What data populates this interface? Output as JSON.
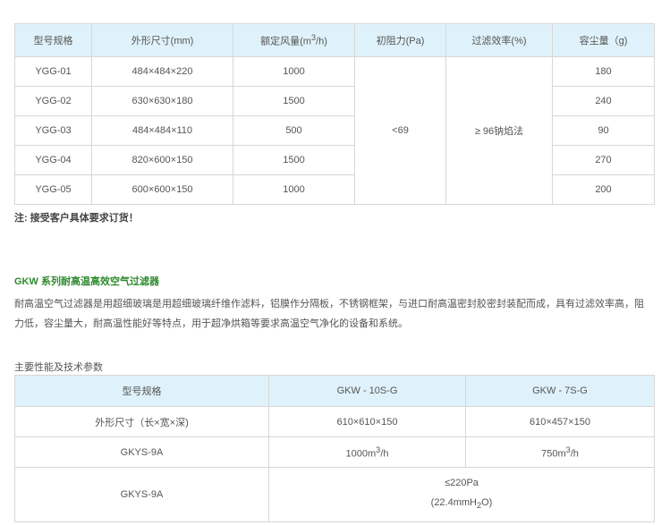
{
  "table1": {
    "headers": {
      "model": "型号规格",
      "size": "外形尺寸(mm)",
      "airflow_pre": "额定风量(m",
      "airflow_sup": "3",
      "airflow_post": "/h)",
      "resistance": "初阻力(Pa)",
      "efficiency": "过滤效率(%)",
      "dust": "容尘量（g)"
    },
    "rows": [
      {
        "model": "YGG-01",
        "size": "484×484×220",
        "airflow": "1000",
        "dust": "180"
      },
      {
        "model": "YGG-02",
        "size": "630×630×180",
        "airflow": "1500",
        "dust": "240"
      },
      {
        "model": "YGG-03",
        "size": "484×484×110",
        "airflow": "500",
        "dust": "90"
      },
      {
        "model": "YGG-04",
        "size": "820×600×150",
        "airflow": "1500",
        "dust": "270"
      },
      {
        "model": "YGG-05",
        "size": "600×600×150",
        "airflow": "1000",
        "dust": "200"
      }
    ],
    "resistance": "<69",
    "efficiency": "≥ 96钠焰法"
  },
  "note": "注: 接受客户具体要求订货！",
  "gkw": {
    "title": "GKW 系列耐高温高效空气过滤器",
    "description": "耐高温空气过滤器是用超细玻璃是用超细玻璃纤维作滤料，铝膜作分隔板，不锈钢框架，与进口耐高温密封胶密封装配而成，具有过滤效率高，阻力低，容尘量大，耐高温性能好等特点，用于超净烘箱等要求高温空气净化的设备和系统。",
    "params_title": "主要性能及技术参数"
  },
  "table2": {
    "headers": {
      "model": "型号规格",
      "col1": "GKW - 10S-G",
      "col2": "GKW - 7S-G"
    },
    "row1": {
      "label": "外形尺寸（长×宽×深)",
      "v1": "610×610×150",
      "v2": "610×457×150"
    },
    "row2": {
      "label": "GKYS-9A",
      "v1_pre": "1000m",
      "v1_sup": "3",
      "v1_post": "/h",
      "v2_pre": "750m",
      "v2_sup": "3",
      "v2_post": "/h"
    },
    "row3": {
      "label": "GKYS-9A",
      "line1": "≤220Pa",
      "line2_pre": "(22.4mmH",
      "line2_sub": "2",
      "line2_post": "O)"
    }
  }
}
